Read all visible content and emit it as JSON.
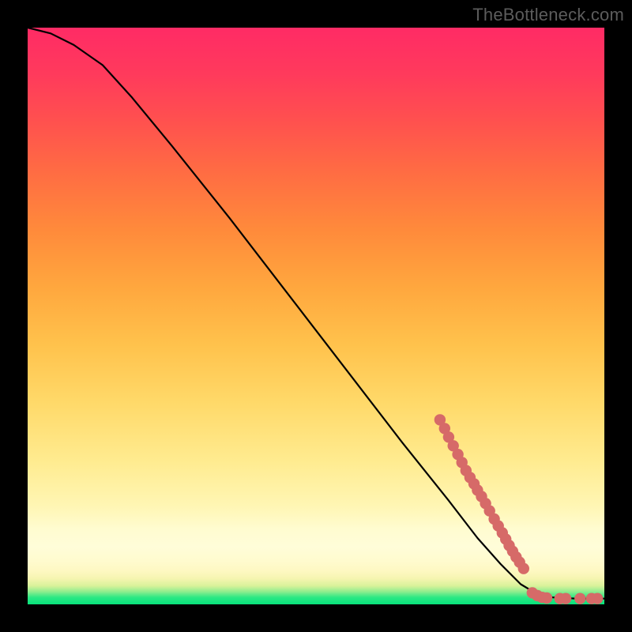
{
  "watermark": "TheBottleneck.com",
  "chart_data": {
    "type": "line",
    "title": "",
    "xlabel": "",
    "ylabel": "",
    "xlim": [
      0,
      100
    ],
    "ylim": [
      0,
      100
    ],
    "curve": [
      {
        "x": 0.0,
        "y": 100.0
      },
      {
        "x": 4.0,
        "y": 99.0
      },
      {
        "x": 8.0,
        "y": 97.0
      },
      {
        "x": 13.0,
        "y": 93.5
      },
      {
        "x": 18.0,
        "y": 88.0
      },
      {
        "x": 25.0,
        "y": 79.5
      },
      {
        "x": 35.0,
        "y": 67.0
      },
      {
        "x": 45.0,
        "y": 54.0
      },
      {
        "x": 55.0,
        "y": 41.0
      },
      {
        "x": 65.0,
        "y": 28.0
      },
      {
        "x": 73.0,
        "y": 18.0
      },
      {
        "x": 78.0,
        "y": 11.5
      },
      {
        "x": 82.0,
        "y": 7.0
      },
      {
        "x": 85.5,
        "y": 3.5
      },
      {
        "x": 88.0,
        "y": 2.0
      },
      {
        "x": 91.0,
        "y": 1.2
      },
      {
        "x": 95.0,
        "y": 1.0
      },
      {
        "x": 100.0,
        "y": 1.0
      }
    ],
    "scatter": [
      {
        "x": 71.5,
        "y": 32.0
      },
      {
        "x": 72.3,
        "y": 30.5
      },
      {
        "x": 73.0,
        "y": 29.0
      },
      {
        "x": 73.8,
        "y": 27.5
      },
      {
        "x": 74.6,
        "y": 26.0
      },
      {
        "x": 75.3,
        "y": 24.6
      },
      {
        "x": 76.0,
        "y": 23.2
      },
      {
        "x": 76.7,
        "y": 22.0
      },
      {
        "x": 77.4,
        "y": 20.9
      },
      {
        "x": 78.0,
        "y": 19.8
      },
      {
        "x": 78.7,
        "y": 18.7
      },
      {
        "x": 79.4,
        "y": 17.5
      },
      {
        "x": 80.1,
        "y": 16.2
      },
      {
        "x": 80.9,
        "y": 14.8
      },
      {
        "x": 81.6,
        "y": 13.6
      },
      {
        "x": 82.3,
        "y": 12.4
      },
      {
        "x": 82.9,
        "y": 11.3
      },
      {
        "x": 83.5,
        "y": 10.2
      },
      {
        "x": 84.1,
        "y": 9.2
      },
      {
        "x": 84.7,
        "y": 8.2
      },
      {
        "x": 85.3,
        "y": 7.3
      },
      {
        "x": 86.0,
        "y": 6.2
      },
      {
        "x": 87.5,
        "y": 2.0
      },
      {
        "x": 88.4,
        "y": 1.5
      },
      {
        "x": 89.2,
        "y": 1.2
      },
      {
        "x": 90.0,
        "y": 1.1
      },
      {
        "x": 92.3,
        "y": 1.0
      },
      {
        "x": 93.3,
        "y": 1.0
      },
      {
        "x": 95.8,
        "y": 1.0
      },
      {
        "x": 97.8,
        "y": 1.0
      },
      {
        "x": 98.8,
        "y": 1.0
      }
    ],
    "point_color": "#d66a68",
    "curve_color": "#000000"
  }
}
